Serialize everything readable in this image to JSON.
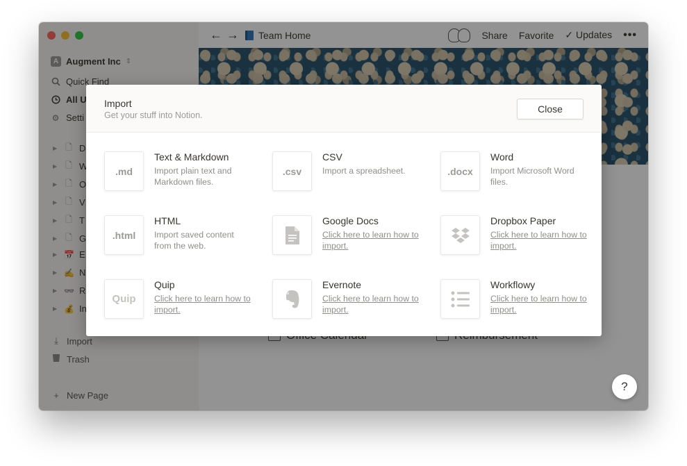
{
  "sidebar": {
    "workspace_initial": "A",
    "workspace_name": "Augment Inc",
    "workspace_chevron": "⇕",
    "quick_find": "Quick Find",
    "all_updates": "All U",
    "settings": "Setti",
    "pages": [
      {
        "icon": "doc-icon",
        "glyph": "🗋",
        "label": "D"
      },
      {
        "icon": "doc-icon",
        "glyph": "🗋",
        "label": "W"
      },
      {
        "icon": "doc-icon",
        "glyph": "🗋",
        "label": "O"
      },
      {
        "icon": "doc-icon",
        "glyph": "🗋",
        "label": "V"
      },
      {
        "icon": "doc-icon",
        "glyph": "🗋",
        "label": "T"
      },
      {
        "icon": "doc-icon",
        "glyph": "🗋",
        "label": "G"
      },
      {
        "icon": "calendar-icon",
        "glyph": "📅",
        "label": "E"
      },
      {
        "icon": "writing-hand-icon",
        "glyph": "✍",
        "label": "N"
      },
      {
        "icon": "glasses-icon",
        "glyph": "👓",
        "label": "R"
      },
      {
        "icon": "money-bag-icon",
        "glyph": "💰",
        "label": "In"
      }
    ],
    "import": "Import",
    "trash": "Trash",
    "new_page": "New Page"
  },
  "topbar": {
    "back_arrow": "←",
    "forward_arrow": "→",
    "page_title": "Team Home",
    "share": "Share",
    "favorite": "Favorite",
    "updates": "Updates",
    "updates_check": "✓",
    "more": "•••"
  },
  "main": {
    "items": [
      "Office Calendar",
      "Reimbursement"
    ],
    "help": "?"
  },
  "modal": {
    "title": "Import",
    "subtitle": "Get your stuff into Notion.",
    "close": "Close",
    "options": [
      {
        "box": ".md",
        "title": "Text & Markdown",
        "desc": "Import plain text and Markdown files.",
        "link": false
      },
      {
        "box": ".csv",
        "title": "CSV",
        "desc": "Import a spreadsheet.",
        "link": false
      },
      {
        "box": ".docx",
        "title": "Word",
        "desc": "Import Microsoft Word files.",
        "link": false
      },
      {
        "box": ".html",
        "title": "HTML",
        "desc": "Import saved content from the web.",
        "link": false
      },
      {
        "box": "",
        "title": "Google Docs",
        "desc": "Click here to learn how to import.",
        "link": true
      },
      {
        "box": "",
        "title": "Dropbox Paper",
        "desc": "Click here to learn how to import.",
        "link": true
      },
      {
        "box": "Quip",
        "title": "Quip",
        "desc": "Click here to learn how to import.",
        "link": true
      },
      {
        "box": "",
        "title": "Evernote",
        "desc": "Click here to learn how to import.",
        "link": true
      },
      {
        "box": "",
        "title": "Workflowy",
        "desc": "Click here to learn how to import.",
        "link": true
      }
    ]
  }
}
